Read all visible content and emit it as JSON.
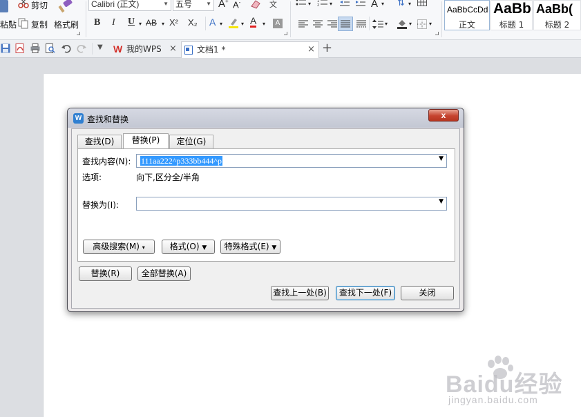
{
  "ribbon": {
    "cut_label": "剪切",
    "copy_label": "复制",
    "format_painter_label": "格式刷",
    "paste_label": "粘贴",
    "font_name": "Calibri (正文)",
    "font_size": "五号",
    "bold": "B",
    "italic": "I",
    "underline": "U",
    "strike": "AB",
    "superscript": "X²",
    "subscript": "X₂",
    "font_color_glyph": "A",
    "phonetic_glyph": "文",
    "styles": [
      {
        "preview": "AaBbCcDd",
        "caption": "正文"
      },
      {
        "preview": "AaBb",
        "caption": "标题 1"
      },
      {
        "preview": "AaBb(",
        "caption": "标题 2"
      }
    ]
  },
  "tabbar": {
    "tabs": [
      {
        "label": "我的WPS",
        "close": "×"
      },
      {
        "label": "文档1 *",
        "close": "×"
      }
    ],
    "new_tab": "+"
  },
  "dialog": {
    "title": "查找和替换",
    "close_glyph": "x",
    "tabs": [
      {
        "label": "查找(D)",
        "active": false
      },
      {
        "label": "替换(P)",
        "active": true
      },
      {
        "label": "定位(G)",
        "active": false
      }
    ],
    "find_label": "查找内容(N):",
    "find_value": "111aa222^p333bb444^p",
    "options_label": "选项:",
    "options_value": "向下,区分全/半角",
    "replace_label": "替换为(I):",
    "replace_value": "",
    "advanced_search": "高级搜索(M)",
    "format_label": "格式(O)",
    "special_format": "特殊格式(E)",
    "replace_btn": "替换(R)",
    "replace_all_btn": "全部替换(A)",
    "find_prev_btn": "查找上一处(B)",
    "find_next_btn": "查找下一处(F)",
    "close_btn": "关闭"
  },
  "watermark": {
    "logo": "Baidu经验",
    "url": "jingyan.baidu.com"
  }
}
